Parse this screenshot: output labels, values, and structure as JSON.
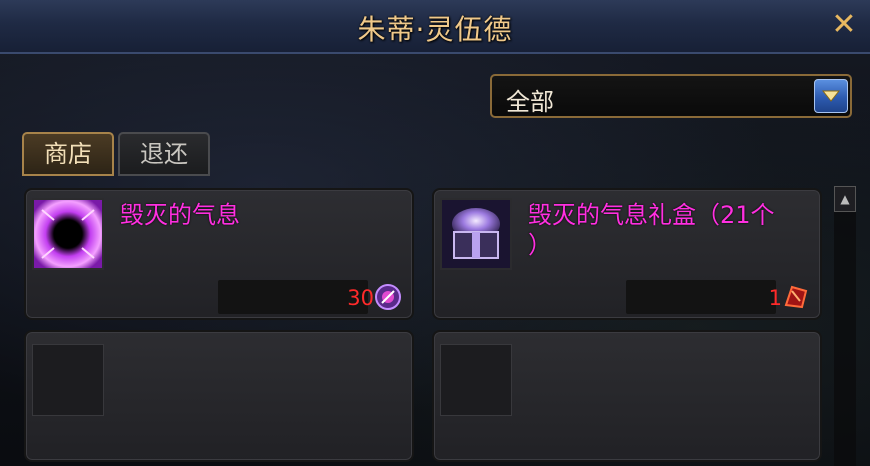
{
  "window": {
    "title": "朱蒂·灵伍德",
    "close_glyph": "✕"
  },
  "filter": {
    "selected": "全部"
  },
  "tabs": [
    {
      "label": "商店",
      "active": true
    },
    {
      "label": "退还",
      "active": false
    }
  ],
  "items": [
    {
      "name": "毁灭的气息",
      "price": "30",
      "icon": "dark-orb-icon",
      "currency_icon": "purple-token-icon"
    },
    {
      "name": "毁灭的气息礼盒（21个\n）",
      "price": "1",
      "icon": "gift-box-icon",
      "currency_icon": "red-shard-icon"
    }
  ],
  "colors": {
    "item_name": "#ff2fe0",
    "price": "#ff2a2a",
    "title": "#f0c98a",
    "accent_border": "#8a6a38"
  }
}
